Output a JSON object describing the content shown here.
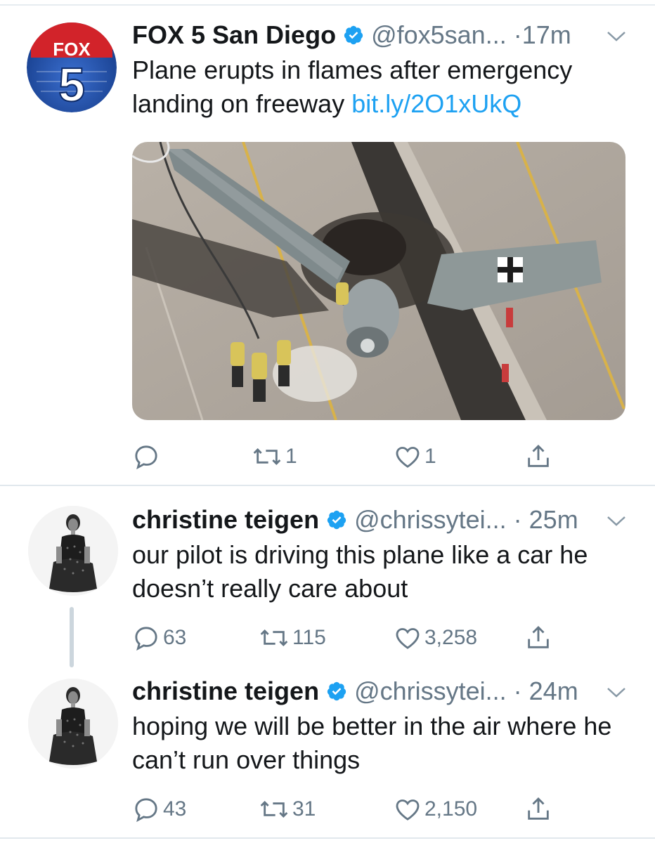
{
  "tweets": [
    {
      "name": "FOX 5 San Diego",
      "handle": "@fox5san...",
      "time": "·17m",
      "text_plain": "Plane erupts in flames after emergency landing on freeway ",
      "link": "bit.ly/2O1xUkQ",
      "logo_text": "FOX",
      "logo_num": "5",
      "replies": "",
      "retweets": "1",
      "likes": "1"
    },
    {
      "name": "christine teigen",
      "handle": "@chrissytei...",
      "time": "· 25m",
      "text_plain": "our pilot is driving this plane like a car he doesn’t really care about",
      "replies": "63",
      "retweets": "115",
      "likes": "3,258"
    },
    {
      "name": "christine teigen",
      "handle": "@chrissytei...",
      "time": "· 24m",
      "text_plain": "hoping we will be better in the air where he can’t run over things",
      "replies": "43",
      "retweets": "31",
      "likes": "2,150"
    }
  ],
  "colors": {
    "verified": "#1da1f2",
    "link": "#1da1f2",
    "secondary": "#657786",
    "fox_red": "#d2232a",
    "fox_blue": "#1f4ea3"
  },
  "icons": [
    "reply-icon",
    "retweet-icon",
    "like-icon",
    "share-icon",
    "verified-badge-icon",
    "chevron-down-icon"
  ]
}
